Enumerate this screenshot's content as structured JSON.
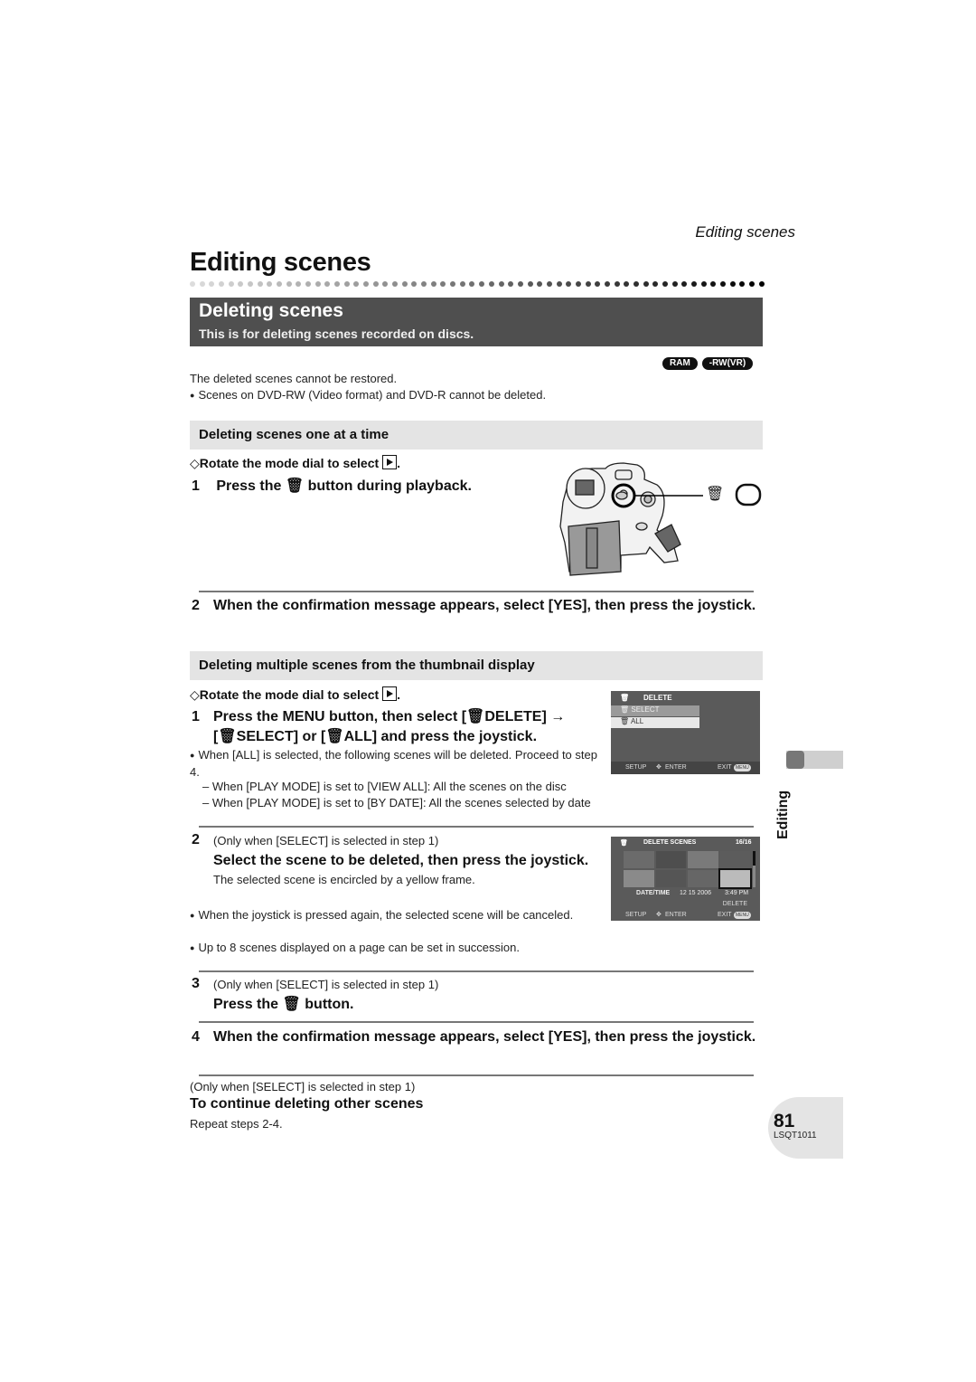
{
  "running_header": "Editing scenes",
  "page_title": "Editing scenes",
  "section": {
    "title": "Deleting scenes",
    "subtitle": "This is for deleting scenes recorded on discs."
  },
  "badges": [
    "RAM",
    "-RW(VR)"
  ],
  "intro": {
    "note": "The deleted scenes cannot be restored.",
    "bullet": "Scenes on DVD-RW (Video format) and DVD-R cannot be deleted."
  },
  "one_at_a_time": {
    "heading": "Deleting scenes one at a time",
    "prep": "Rotate the mode dial to select",
    "steps": [
      {
        "num": "1",
        "text_before": "Press the",
        "icon": "trash-icon",
        "text_after": "button during playback."
      },
      {
        "num": "2",
        "text": "When the confirmation message appears, select [YES], then press the joystick."
      }
    ]
  },
  "multiple": {
    "heading": "Deleting multiple scenes from the thumbnail display",
    "prep": "Rotate the mode dial to select",
    "step1": {
      "num": "1",
      "line1_a": "Press the MENU button, then select [",
      "line1_b": "DELETE] →",
      "line2_a": "[",
      "line2_b": "SELECT] or [",
      "line2_c": "ALL] and press the joystick.",
      "bullet": "When [ALL] is selected, the following scenes will be deleted. Proceed to step 4.",
      "dashes": [
        "When [PLAY MODE] is set to [VIEW ALL]: All the scenes on the disc",
        "When [PLAY MODE] is set to [BY DATE]: All the scenes selected by date"
      ]
    },
    "menu_screen": {
      "title": "DELETE",
      "items": [
        "SELECT",
        "ALL"
      ],
      "footer_left": "SETUP",
      "footer_mid": "ENTER",
      "footer_right": "EXIT",
      "footer_btn": "MENU"
    },
    "step2": {
      "num": "2",
      "condition": "(Only when [SELECT] is selected in step 1)",
      "title": "Select the scene to be deleted, then press the joystick.",
      "note": "The selected scene is encircled by a yellow frame.",
      "bullets": [
        "When the joystick is pressed again, the selected scene will be canceled.",
        "Up to 8 scenes displayed on a page can be set in succession."
      ]
    },
    "thumb_screen": {
      "title": "DELETE SCENES",
      "counter": "16/16",
      "date_label": "DATE/TIME",
      "date": "12 15 2006",
      "time": "3:49 PM",
      "delete_label": "DELETE",
      "footer_left": "SETUP",
      "footer_mid": "ENTER",
      "footer_right": "EXIT",
      "footer_btn": "MENU"
    },
    "step3": {
      "num": "3",
      "condition": "(Only when [SELECT] is selected in step 1)",
      "text_before": "Press the",
      "text_after": "button."
    },
    "step4": {
      "num": "4",
      "text": "When the confirmation message appears, select [YES], then press the joystick."
    },
    "continue": {
      "condition": "(Only when [SELECT] is selected in step 1)",
      "heading": "To continue deleting other scenes",
      "text": "Repeat steps 2-4."
    }
  },
  "side_tab": "Editing",
  "page_number": "81",
  "doc_code": "LSQT1011"
}
